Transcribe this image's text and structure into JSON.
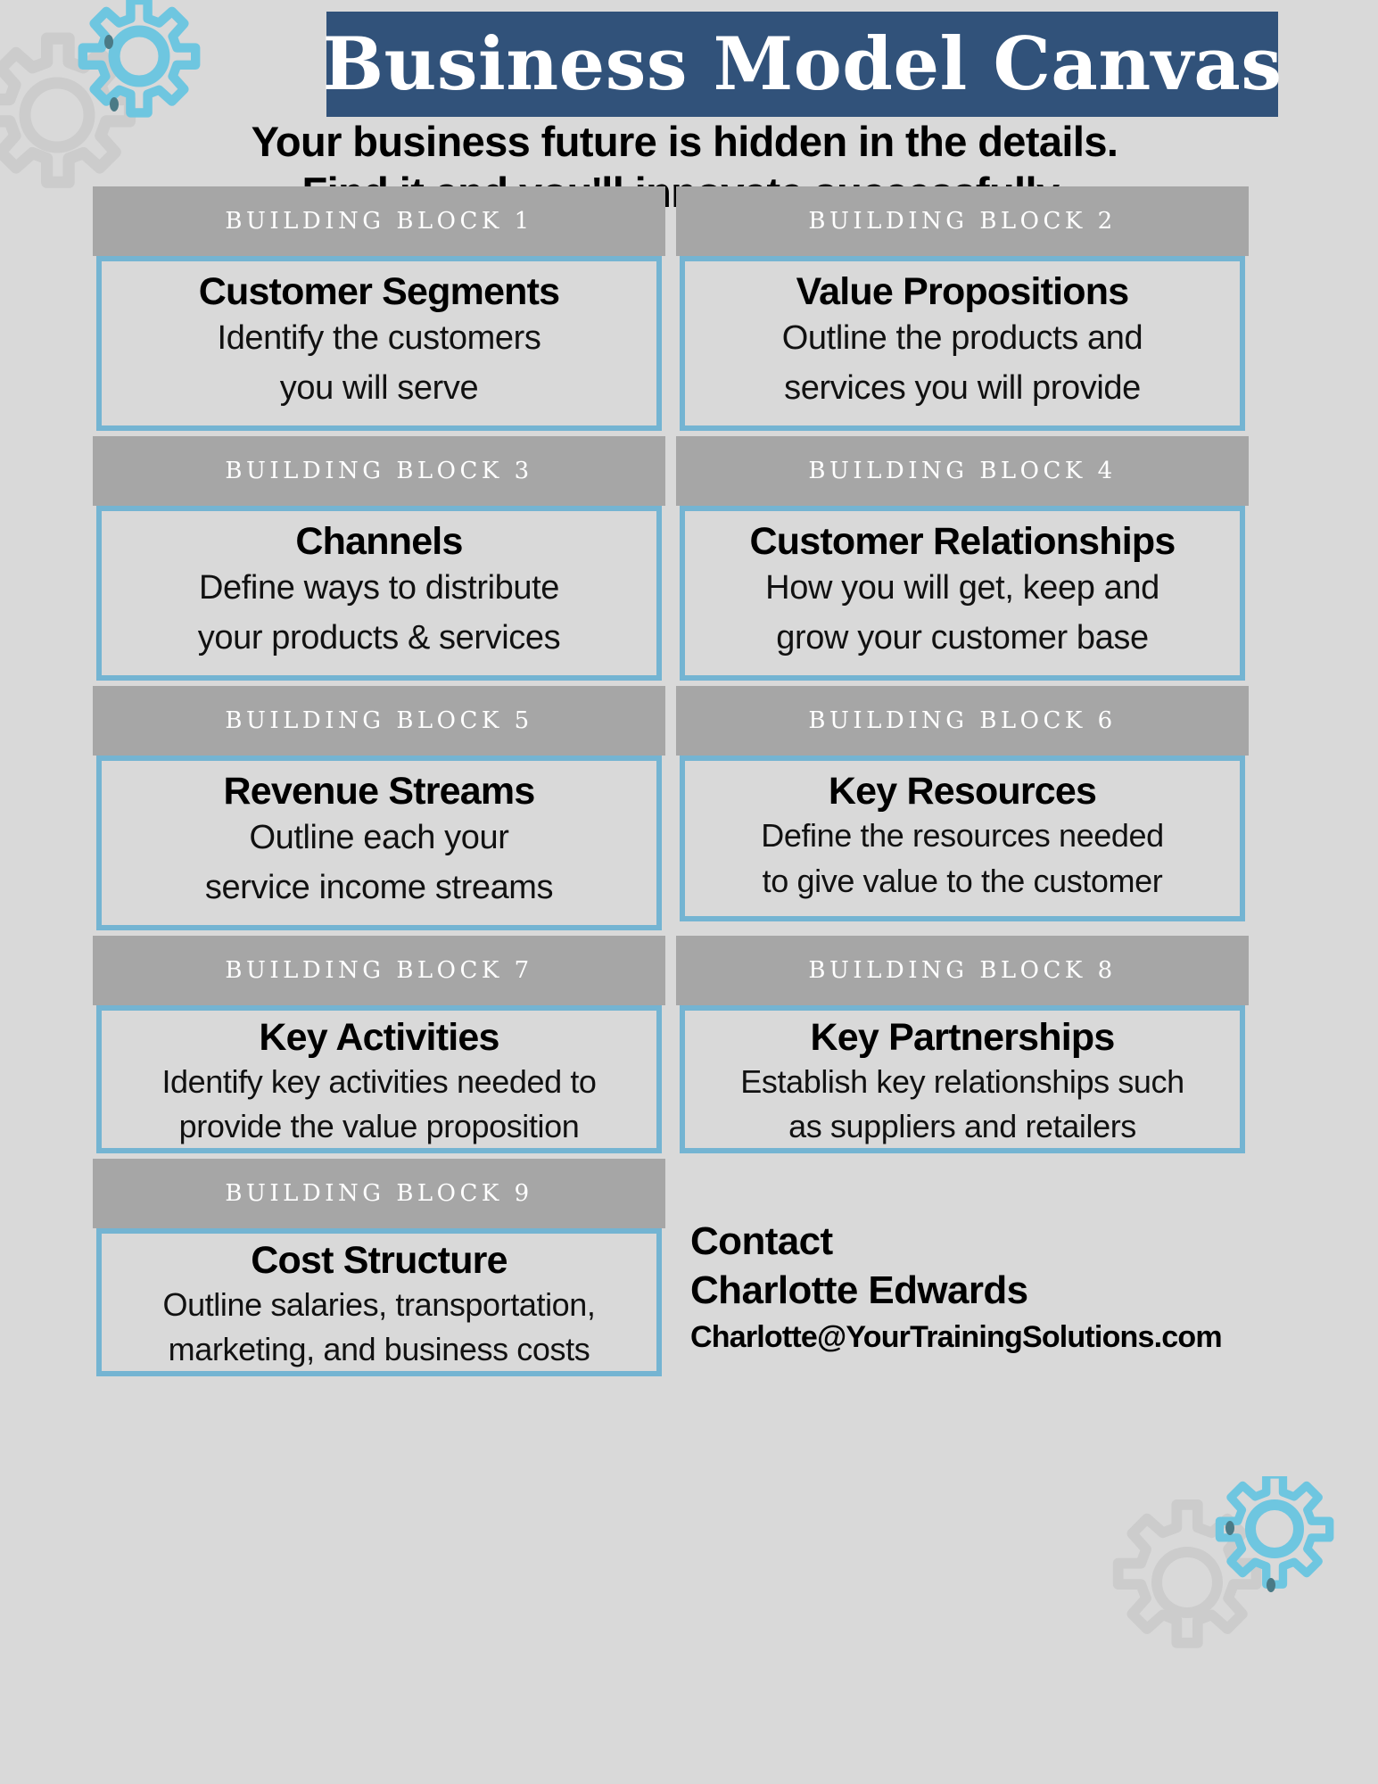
{
  "header": {
    "title": "Business Model Canvas",
    "subtitle_line_1": "Your business future is hidden in the details.",
    "subtitle_line_2": "Find it and you'll innovate successfully.",
    "title_banner_color": "#31527a",
    "title_text_color": "#ffffff"
  },
  "theme": {
    "background": "#d9d9d9",
    "block_header_bg": "#a6a6a6",
    "block_border": "#74b4d2",
    "accent_gear": "#6ec6e0",
    "muted_gear": "#cccccc",
    "text": "#000000"
  },
  "blocks": [
    {
      "eyebrow": "BUILDING BLOCK 1",
      "title": "Customer Segments",
      "desc_lines": [
        "Identify the customers",
        "you will serve"
      ]
    },
    {
      "eyebrow": "BUILDING BLOCK 2",
      "title": "Value Propositions",
      "desc_lines": [
        "Outline the products and",
        "services you will provide"
      ]
    },
    {
      "eyebrow": "BUILDING BLOCK 3",
      "title": "Channels",
      "desc_lines": [
        "Define ways to distribute",
        "your products & services"
      ]
    },
    {
      "eyebrow": "BUILDING BLOCK 4",
      "title": "Customer Relationships",
      "desc_lines": [
        "How you will get, keep and",
        "grow your customer base"
      ]
    },
    {
      "eyebrow": "BUILDING BLOCK 5",
      "title": "Revenue Streams",
      "desc_lines": [
        "Outline each your",
        "service income streams"
      ]
    },
    {
      "eyebrow": "BUILDING BLOCK 6",
      "title": "Key Resources",
      "desc_lines": [
        "Define the resources needed",
        "to give value to the customer"
      ]
    },
    {
      "eyebrow": "BUILDING BLOCK 7",
      "title": "Key Activities",
      "desc_lines": [
        "Identify key activities needed to",
        "provide the value proposition"
      ]
    },
    {
      "eyebrow": "BUILDING BLOCK 8",
      "title": "Key Partnerships",
      "desc_lines": [
        "Establish key relationships such",
        "as suppliers and retailers"
      ]
    },
    {
      "eyebrow": "BUILDING BLOCK 9",
      "title": "Cost Structure",
      "desc_lines": [
        "Outline salaries, transportation,",
        "marketing, and business costs"
      ]
    }
  ],
  "contact": {
    "heading": "Contact",
    "name": "Charlotte Edwards",
    "email": "Charlotte@YourTrainingSolutions.com"
  },
  "icons": {
    "gear_top_left": "gears-icon",
    "gear_bottom_right": "gears-icon"
  }
}
